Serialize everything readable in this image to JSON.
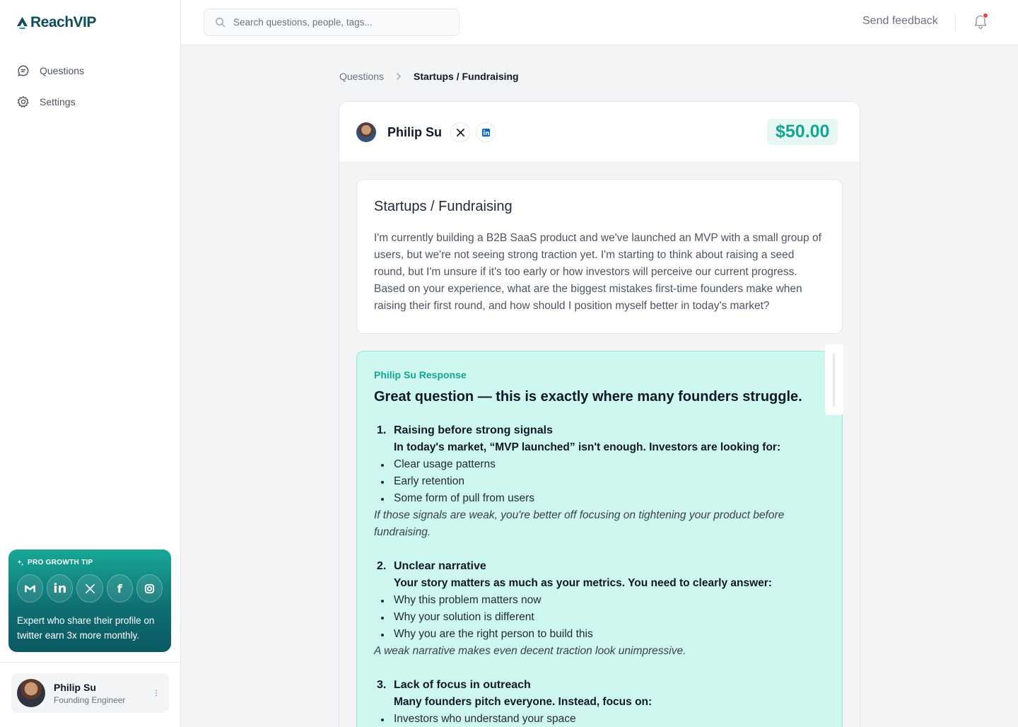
{
  "app": {
    "name": "ReachVIP"
  },
  "sidebar": {
    "nav": [
      {
        "label": "Questions",
        "icon": "chat-icon"
      },
      {
        "label": "Settings",
        "icon": "gear-icon"
      }
    ],
    "tip": {
      "title": "PRO GROWTH TIP",
      "socials": [
        "gmail-icon",
        "linkedin-icon",
        "x-icon",
        "facebook-icon",
        "instagram-icon"
      ],
      "text": "Expert who share their profile on twitter earn 3x more monthly."
    },
    "profile": {
      "name": "Philip Su",
      "role": "Founding Engineer"
    }
  },
  "topbar": {
    "search_placeholder": "Search questions, people, tags...",
    "feedback_label": "Send feedback",
    "has_notification": true
  },
  "breadcrumb": {
    "parent": "Questions",
    "current": "Startups / Fundraising"
  },
  "question": {
    "asker": "Philip Su",
    "price": "$50.00",
    "title": "Startups / Fundraising",
    "body": "I'm currently building a B2B SaaS product and we've launched an MVP with a small group of users, but we're not seeing strong traction yet. I'm starting to think about raising a seed round, but I'm unsure if it's too early or how investors will perceive our current progress. Based on your experience, what are the biggest mistakes first-time founders make when raising their first round, and how should I position myself better in today's market?"
  },
  "response": {
    "label": "Philip Su Response",
    "headline": "Great question — this is exactly where many founders struggle.",
    "sections": [
      {
        "num": "1.",
        "title": "Raising before strong signals",
        "lead": "In today's market, “MVP launched” isn't enough. Investors are looking for:",
        "bullets": [
          "Clear usage patterns",
          "Early retention",
          "Some form of pull from users"
        ],
        "note": "If those signals are weak, you're better off focusing on tightening your product before fundraising."
      },
      {
        "num": "2.",
        "title": "Unclear narrative",
        "lead": "Your story matters as much as your metrics. You need to clearly answer:",
        "bullets": [
          "Why this problem matters now",
          "Why your solution is different",
          "Why you are the right person to build this"
        ],
        "note": "A weak narrative makes even decent traction look unimpressive."
      },
      {
        "num": "3.",
        "title": "Lack of focus in outreach",
        "lead": "Many founders pitch everyone. Instead, focus on:",
        "bullets": [
          "Investors who understand your space"
        ],
        "note": ""
      }
    ]
  },
  "colors": {
    "accent": "#14a693",
    "brand": "#0f4c5c",
    "response_bg": "#cdf7ef"
  }
}
